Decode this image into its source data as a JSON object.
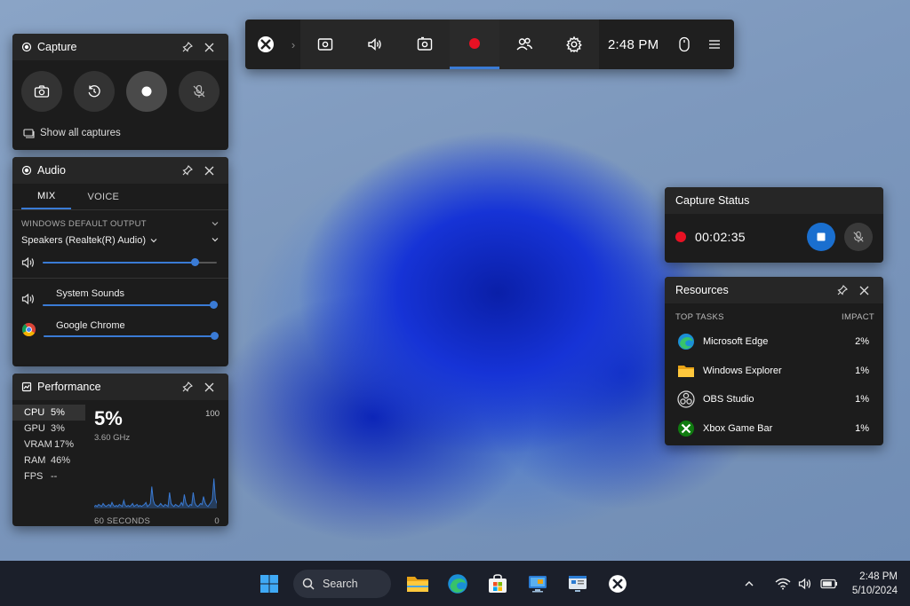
{
  "gamebar": {
    "time": "2:48 PM",
    "chevron": "›",
    "icons": [
      "xbox-icon",
      "widget-menu-icon",
      "audio-icon",
      "capture-icon",
      "record-icon",
      "social-icon",
      "settings-icon",
      "mouse-icon",
      "menu-icon"
    ]
  },
  "capture": {
    "title": "Capture",
    "show_all": "Show all captures"
  },
  "audio": {
    "title": "Audio",
    "tabs": [
      "MIX",
      "VOICE"
    ],
    "default_output_label": "WINDOWS DEFAULT OUTPUT",
    "device": "Speakers (Realtek(R) Audio)",
    "master_volume": 0.87,
    "apps": [
      {
        "name": "System Sounds",
        "volume": 1.0
      },
      {
        "name": "Google Chrome",
        "volume": 1.0
      }
    ]
  },
  "performance": {
    "title": "Performance",
    "metrics": [
      {
        "key": "CPU",
        "value": "5%"
      },
      {
        "key": "GPU",
        "value": "3%"
      },
      {
        "key": "VRAM",
        "value": "17%"
      },
      {
        "key": "RAM",
        "value": "46%"
      },
      {
        "key": "FPS",
        "value": "--"
      }
    ],
    "big_value": "5%",
    "sub": "3.60 GHz",
    "max": "100",
    "axis_left": "60 SECONDS",
    "axis_right": "0",
    "history": [
      2,
      3,
      2,
      4,
      3,
      2,
      5,
      3,
      2,
      3,
      4,
      2,
      6,
      3,
      2,
      3,
      2,
      4,
      3,
      2,
      8,
      3,
      2,
      3,
      2,
      3,
      5,
      2,
      3,
      4,
      2,
      3,
      2,
      3,
      4,
      6,
      2,
      3,
      5,
      22,
      8,
      4,
      3,
      2,
      3,
      5,
      3,
      2,
      4,
      3,
      2,
      16,
      5,
      3,
      2,
      4,
      3,
      2,
      3,
      6,
      3,
      14,
      6,
      3,
      2,
      4,
      3,
      16,
      6,
      3,
      2,
      3,
      5,
      4,
      12,
      6,
      3,
      2,
      4,
      6,
      9,
      30,
      10,
      5
    ]
  },
  "capture_status": {
    "title": "Capture Status",
    "elapsed": "00:02:35"
  },
  "resources": {
    "title": "Resources",
    "col_tasks": "TOP TASKS",
    "col_impact": "IMPACT",
    "rows": [
      {
        "name": "Microsoft Edge",
        "impact": "2%",
        "icon": "edge-icon"
      },
      {
        "name": "Windows Explorer",
        "impact": "1%",
        "icon": "folder-icon"
      },
      {
        "name": "OBS Studio",
        "impact": "1%",
        "icon": "obs-icon"
      },
      {
        "name": "Xbox Game Bar",
        "impact": "1%",
        "icon": "xbox-icon"
      }
    ]
  },
  "taskbar": {
    "search_label": "Search",
    "time": "2:48 PM",
    "date": "5/10/2024"
  },
  "colors": {
    "accent": "#3a7bd5",
    "record": "#e81123"
  }
}
